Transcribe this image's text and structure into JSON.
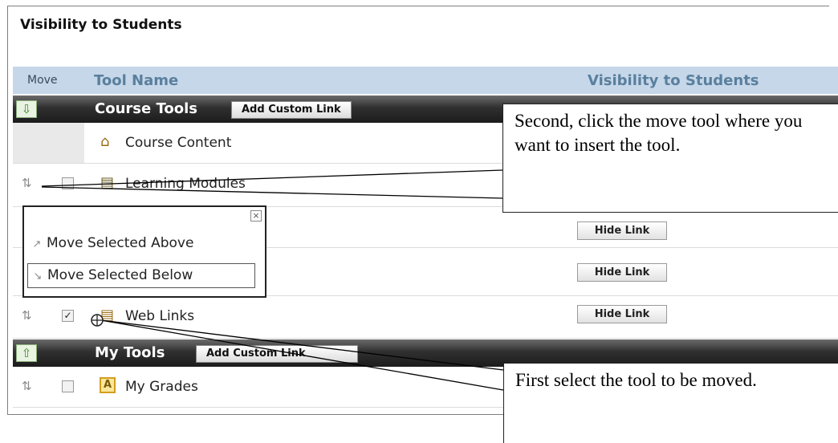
{
  "page": {
    "title": "Visibility to Students"
  },
  "table_header": {
    "move": "Move",
    "tool_name": "Tool Name",
    "visibility": "Visibility to Students"
  },
  "sections": [
    {
      "title": "Course Tools",
      "add_link_label": "Add Custom Link",
      "arrow": "arrow-down-icon"
    },
    {
      "title": "My Tools",
      "add_link_label": "Add Custom Link",
      "arrow": "arrow-up-icon"
    }
  ],
  "course_tools": [
    {
      "name": "Course Content",
      "icon": "home-icon",
      "hide_label": ""
    },
    {
      "name": "Learning Modules",
      "icon": "document-icon",
      "hide_label": ""
    },
    {
      "name": "",
      "icon": "",
      "hide_label": "Hide Link"
    },
    {
      "name": "",
      "icon": "",
      "hide_label": "Hide Link"
    },
    {
      "name": "Web Links",
      "icon": "web-links-icon",
      "hide_label": "Hide Link",
      "checked": true
    }
  ],
  "my_tools": [
    {
      "name": "My Grades",
      "icon": "grades-icon"
    }
  ],
  "move_popup": {
    "above_label": "Move Selected Above",
    "below_label": "Move Selected Below"
  },
  "callouts": {
    "second": "Second, click the move tool where you want to insert the tool.",
    "first": "First select the tool to be moved."
  }
}
